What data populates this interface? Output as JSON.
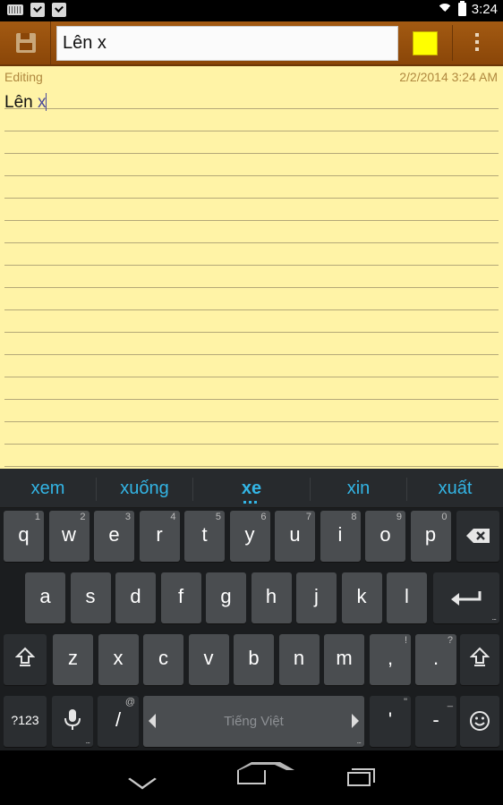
{
  "status_bar": {
    "time": "3:24",
    "icons": [
      "keyboard-icon",
      "checkbox-icon",
      "checkbox-icon",
      "wifi-icon",
      "battery-icon"
    ]
  },
  "action_bar": {
    "title_value": "Lên x",
    "note_color": "#ffff00",
    "save_icon": "floppy-disk-icon",
    "overflow_icon": "overflow-menu-icon"
  },
  "note": {
    "status": "Editing",
    "datetime": "2/2/2014 3:24 AM",
    "text_committed": "Lên ",
    "text_composing": "x"
  },
  "keyboard": {
    "suggestions": [
      "xem",
      "xuống",
      "xe",
      "xin",
      "xuất"
    ],
    "row1": [
      {
        "label": "q",
        "hint": "1"
      },
      {
        "label": "w",
        "hint": "2"
      },
      {
        "label": "e",
        "hint": "3"
      },
      {
        "label": "r",
        "hint": "4"
      },
      {
        "label": "t",
        "hint": "5"
      },
      {
        "label": "y",
        "hint": "6"
      },
      {
        "label": "u",
        "hint": "7"
      },
      {
        "label": "i",
        "hint": "8"
      },
      {
        "label": "o",
        "hint": "9"
      },
      {
        "label": "p",
        "hint": "0"
      }
    ],
    "row2": [
      "a",
      "s",
      "d",
      "f",
      "g",
      "h",
      "j",
      "k",
      "l"
    ],
    "row3": [
      "z",
      "x",
      "c",
      "v",
      "b",
      "n",
      "m"
    ],
    "comma": {
      "label": ",",
      "hint": "!"
    },
    "period": {
      "label": ".",
      "hint": "?"
    },
    "symbols_label": "?123",
    "slash": {
      "label": "/",
      "hint": "@"
    },
    "space_label": "Tiếng Việt",
    "apostrophe": {
      "label": "'",
      "hint": "\""
    },
    "dash": {
      "label": "-",
      "hint": "_"
    },
    "accent_color": "#33b5e5"
  },
  "nav_bar": {
    "icons": [
      "back-icon",
      "home-icon",
      "recent-apps-icon"
    ]
  }
}
